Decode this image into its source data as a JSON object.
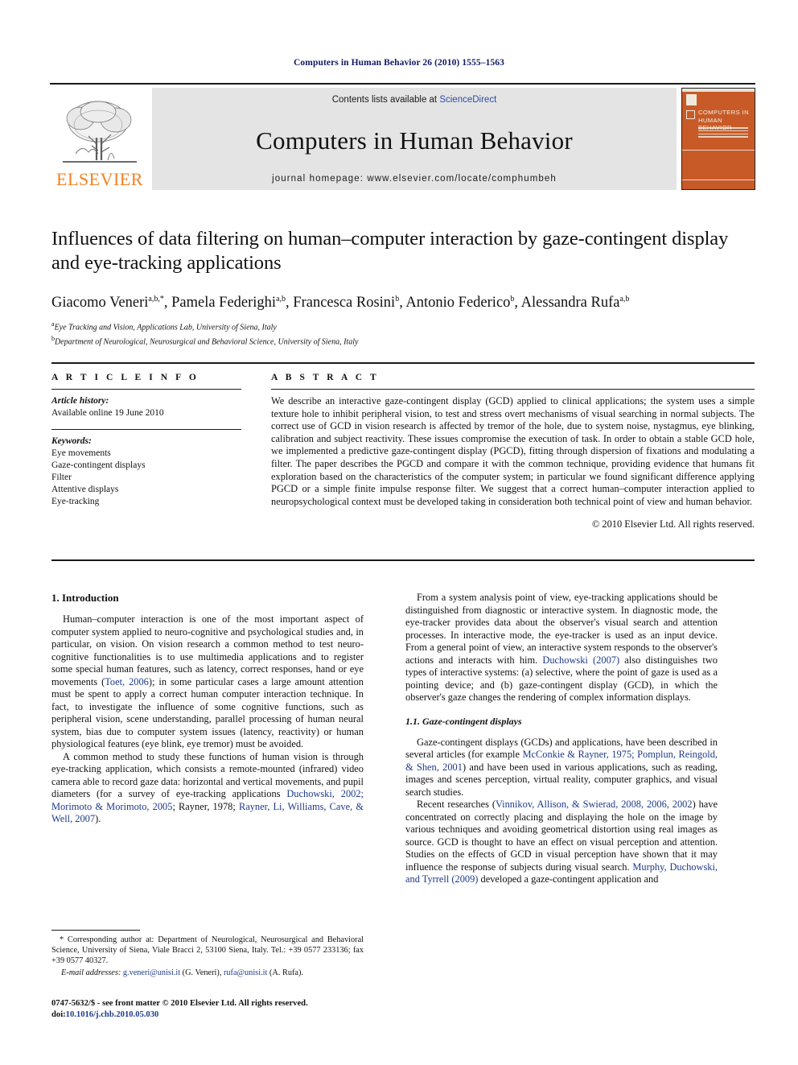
{
  "running_head": "Computers in Human Behavior 26 (2010) 1555–1563",
  "masthead": {
    "publisher_name": "ELSEVIER",
    "contents_prefix": "Contents lists available at ",
    "contents_link": "ScienceDirect",
    "journal_title": "Computers in Human Behavior",
    "homepage": "journal homepage: www.elsevier.com/locate/comphumbeh",
    "cover_title_line1": "COMPUTERS IN",
    "cover_title_line2": "HUMAN BEHAVIOR",
    "cover_color": "#c85a27",
    "elsevier_orange": "#f08124"
  },
  "article": {
    "title": "Influences of data filtering on human–computer interaction by gaze-contingent display and eye-tracking applications",
    "authors": [
      {
        "name": "Giacomo Veneri",
        "marks": "a,b,*"
      },
      {
        "name": "Pamela Federighi",
        "marks": "a,b"
      },
      {
        "name": "Francesca Rosini",
        "marks": "b"
      },
      {
        "name": "Antonio Federico",
        "marks": "b"
      },
      {
        "name": "Alessandra Rufa",
        "marks": "a,b"
      }
    ],
    "affiliations": [
      {
        "mark": "a",
        "text": "Eye Tracking and Vision, Applications Lab, University of Siena, Italy"
      },
      {
        "mark": "b",
        "text": "Department of Neurological, Neurosurgical and Behavioral Science, University of Siena, Italy"
      }
    ]
  },
  "info_panel": {
    "heading": "A R T I C L E   I N F O",
    "history_label": "Article history:",
    "history_value": "Available online 19 June 2010",
    "keywords_label": "Keywords:",
    "keywords": [
      "Eye movements",
      "Gaze-contingent displays",
      "Filter",
      "Attentive displays",
      "Eye-tracking"
    ]
  },
  "abstract": {
    "heading": "A B S T R A C T",
    "text": "We describe an interactive gaze-contingent display (GCD) applied to clinical applications; the system uses a simple texture hole to inhibit peripheral vision, to test and stress overt mechanisms of visual searching in normal subjects. The correct use of GCD in vision research is affected by tremor of the hole, due to system noise, nystagmus, eye blinking, calibration and subject reactivity. These issues compromise the execution of task. In order to obtain a stable GCD hole, we implemented a predictive gaze-contingent display (PGCD), fitting through dispersion of fixations and modulating a filter. The paper describes the PGCD and compare it with the common technique, providing evidence that humans fit exploration based on the characteristics of the computer system; in particular we found significant difference applying PGCD or a simple finite impulse response filter. We suggest that a correct human–computer interaction applied to neuropsychological context must be developed taking in consideration both technical point of view and human behavior.",
    "copyright": "© 2010 Elsevier Ltd. All rights reserved."
  },
  "body": {
    "section1_heading": "1. Introduction",
    "left_para_1_a": "Human–computer interaction is one of the most important aspect of computer system applied to neuro-cognitive and psychological studies and, in particular, on vision. On vision research a common method to test neuro-cognitive functionalities is to use multimedia applications and to register some special human features, such as latency, correct responses, hand or eye movements (",
    "left_para_1_cite": "Toet, 2006",
    "left_para_1_b": "); in some particular cases a large amount attention must be spent to apply a correct human computer interaction technique. In fact, to investigate the influence of some cognitive functions, such as peripheral vision, scene understanding, parallel processing of human neural system, bias due to computer system issues (latency, reactivity) or human physiological features (eye blink, eye tremor) must be avoided.",
    "left_para_2_a": "A common method to study these functions of human vision is through eye-tracking application, which consists a remote-mounted (infrared) video camera able to record gaze data: horizontal and vertical movements, and pupil diameters (for a survey of eye-tracking applications ",
    "left_para_2_cite1": "Duchowski, 2002; Morimoto & Morimoto, 2005",
    "left_para_2_mid": "; Rayner, 1978; ",
    "left_para_2_cite2": "Rayner, Li, Williams, Cave, & Well, 2007",
    "left_para_2_b": ").",
    "right_para_1_a": "From a system analysis point of view, eye-tracking applications should be distinguished from diagnostic or interactive system. In diagnostic mode, the eye-tracker provides data about the observer's visual search and attention processes. In interactive mode, the eye-tracker is used as an input device. From a general point of view, an interactive system responds to the observer's actions and interacts with him. ",
    "right_para_1_cite": "Duchowski (2007)",
    "right_para_1_b": " also distinguishes two types of interactive systems: (a) selective, where the point of gaze is used as a pointing device; and (b) gaze-contingent display (GCD), in which the observer's gaze changes the rendering of complex information displays.",
    "subsection_heading": "1.1. Gaze-contingent displays",
    "right_para_2_a": "Gaze-contingent displays (GCDs) and applications, have been described in several articles (for example ",
    "right_para_2_cite": "McConkie & Rayner, 1975; Pomplun, Reingold, & Shen, 2001",
    "right_para_2_b": ") and have been used in various applications, such as reading, images and scenes perception, virtual reality, computer graphics, and visual search studies.",
    "right_para_3_a": "Recent researches (",
    "right_para_3_cite1": "Vinnikov, Allison, & Swierad, 2008, 2006, 2002",
    "right_para_3_b": ") have concentrated on correctly placing and displaying the hole on the image by various techniques and avoiding geometrical distortion using real images as source. GCD is thought to have an effect on visual perception and attention. Studies on the effects of GCD in visual perception have shown that it may influence the response of subjects during visual search. ",
    "right_para_3_cite2": "Murphy, Duchowski, and Tyrrell (2009)",
    "right_para_3_c": " developed a gaze-contingent application and"
  },
  "footnote": {
    "corresponding": "* Corresponding author at: Department of Neurological, Neurosurgical and Behavioral Science, University of Siena, Viale Bracci 2, 53100 Siena, Italy. Tel.: +39 0577 233136; fax +39 0577 40327.",
    "email_label": "E-mail addresses:",
    "email1": "g.veneri@unisi.it",
    "email1_owner": " (G. Veneri), ",
    "email2": "rufa@unisi.it",
    "email2_owner": " (A. Rufa)."
  },
  "imprint": {
    "line1": "0747-5632/$ - see front matter © 2010 Elsevier Ltd. All rights reserved.",
    "doi_prefix": "doi:",
    "doi": "10.1016/j.chb.2010.05.030"
  }
}
